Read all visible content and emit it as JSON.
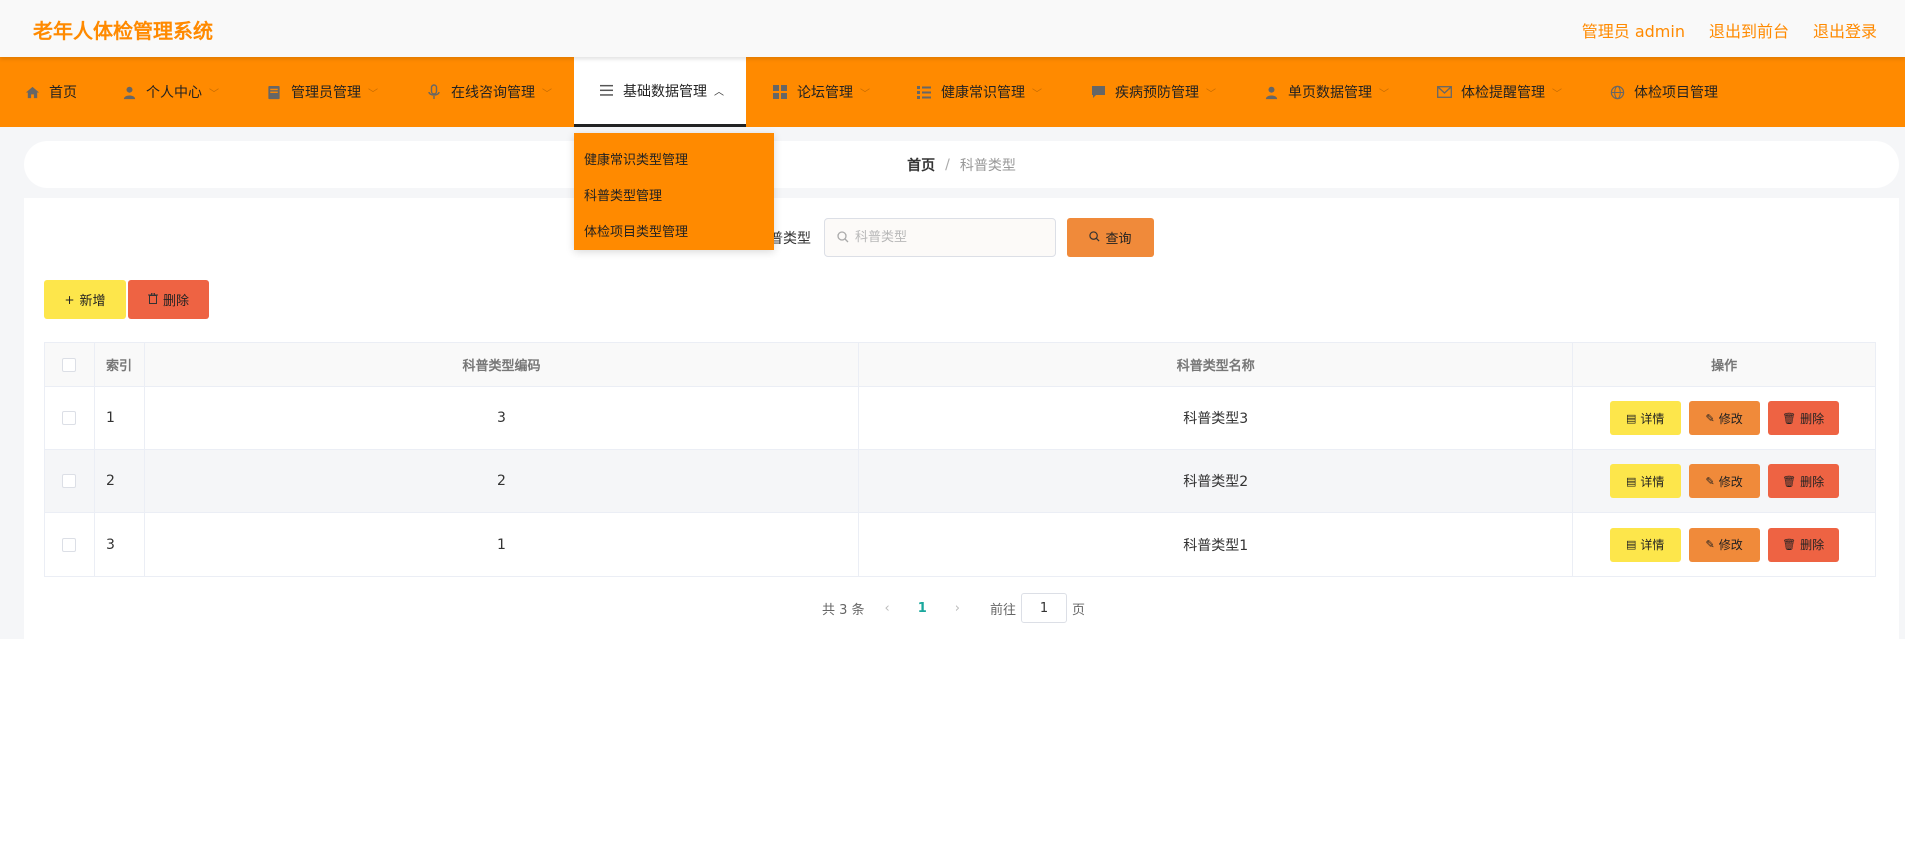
{
  "header": {
    "app_title": "老年人体检管理系统",
    "admin_label": "管理员 admin",
    "exit_front_label": "退出到前台",
    "logout_label": "退出登录"
  },
  "nav": {
    "items": [
      {
        "label": "首页",
        "icon": "home-icon"
      },
      {
        "label": "个人中心",
        "icon": "user-icon"
      },
      {
        "label": "管理员管理",
        "icon": "admin-icon"
      },
      {
        "label": "在线咨询管理",
        "icon": "microphone-icon"
      },
      {
        "label": "基础数据管理",
        "icon": "menu-icon"
      },
      {
        "label": "论坛管理",
        "icon": "grid-icon"
      },
      {
        "label": "健康常识管理",
        "icon": "list-icon"
      },
      {
        "label": "疾病预防管理",
        "icon": "chat-icon"
      },
      {
        "label": "单页数据管理",
        "icon": "user-icon"
      },
      {
        "label": "体检提醒管理",
        "icon": "mail-icon"
      },
      {
        "label": "体检项目管理",
        "icon": "globe-icon"
      }
    ],
    "active_index": 4,
    "dropdown": [
      "健康常识类型管理",
      "科普类型管理",
      "体检项目类型管理"
    ]
  },
  "breadcrumb": {
    "home": "首页",
    "separator": "/",
    "current": "科普类型"
  },
  "search": {
    "label": "普类型",
    "placeholder": "科普类型",
    "value": "",
    "query_label": "查询"
  },
  "actions": {
    "add_label": "新增",
    "delete_label": "删除"
  },
  "table": {
    "headers": {
      "index": "索引",
      "code": "科普类型编码",
      "name": "科普类型名称",
      "ops": "操作"
    },
    "rows": [
      {
        "index": "1",
        "code": "3",
        "name": "科普类型3"
      },
      {
        "index": "2",
        "code": "2",
        "name": "科普类型2"
      },
      {
        "index": "3",
        "code": "1",
        "name": "科普类型1"
      }
    ],
    "row_actions": {
      "detail": "详情",
      "edit": "修改",
      "delete": "删除"
    }
  },
  "pager": {
    "total_text": "共 3 条",
    "current_page": "1",
    "goto_label": "前往",
    "goto_value": "1",
    "page_unit": "页"
  },
  "colors": {
    "primary": "#ff8a00",
    "detail": "#fde64b",
    "edit": "#f08a3a",
    "delete": "#ee6343",
    "accent_page": "#1aa89d"
  }
}
